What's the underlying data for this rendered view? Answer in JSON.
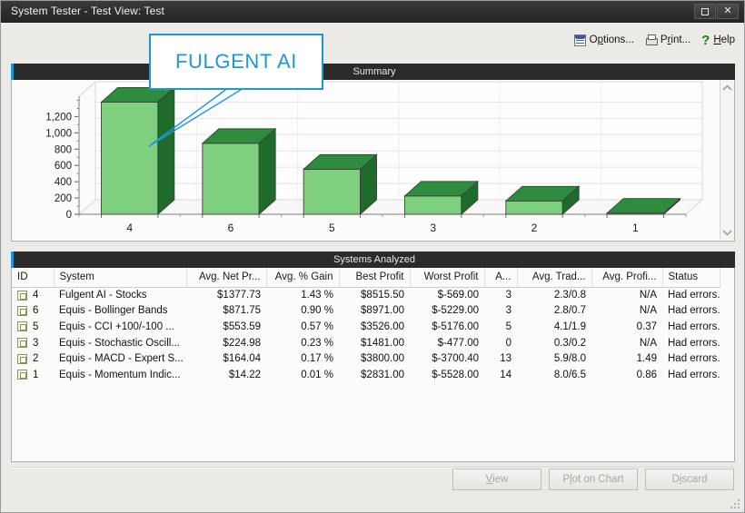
{
  "window": {
    "title": "System Tester - Test View: Test",
    "restore_label": "restore-window",
    "close_label": "✕"
  },
  "toolbar": {
    "options": {
      "pre": "O",
      "accel": "p",
      "post": "tions..."
    },
    "print": {
      "pre": "P",
      "accel": "r",
      "post": "int..."
    },
    "help": {
      "pre": "",
      "accel": "H",
      "post": "elp"
    },
    "help_glyph": "?"
  },
  "summary_panel": {
    "title": "Summary"
  },
  "systems_panel": {
    "title": "Systems Analyzed"
  },
  "chart_data": {
    "type": "bar",
    "title": "Summary",
    "xlabel": "",
    "ylabel": "",
    "categories": [
      "4",
      "6",
      "5",
      "3",
      "2",
      "1"
    ],
    "values": [
      1377.73,
      871.75,
      553.59,
      224.98,
      164.04,
      14.22
    ],
    "ylim": [
      0,
      1450
    ],
    "yticks": [
      0,
      200,
      400,
      600,
      800,
      1000,
      1200
    ],
    "ytick_labels": [
      "0",
      "200",
      "400",
      "600",
      "800",
      "1,000",
      "1,200"
    ],
    "grid": true,
    "legend": "none",
    "style": "3d-column",
    "bar_color": "#7ed07e",
    "bar_top_color": "#2f8b3d",
    "bar_side_color": "#1e6b2c"
  },
  "table": {
    "columns": [
      "ID",
      "System",
      "Avg. Net Pr...",
      "Avg. % Gain",
      "Best Profit",
      "Worst Profit",
      "A...",
      "Avg. Trad...",
      "Avg. Profi...",
      "Status"
    ],
    "rows": [
      {
        "id": "4",
        "system": "Fulgent AI - Stocks",
        "avg_net_profit": "$1377.73",
        "avg_pct_gain": "1.43 %",
        "best_profit": "$8515.50",
        "worst_profit": "$-569.00",
        "a": "3",
        "avg_trad": "2.3/0.8",
        "avg_profit": "N/A",
        "status": "Had errors."
      },
      {
        "id": "6",
        "system": "Equis - Bollinger Bands",
        "avg_net_profit": "$871.75",
        "avg_pct_gain": "0.90 %",
        "best_profit": "$8971.00",
        "worst_profit": "$-5229.00",
        "a": "3",
        "avg_trad": "2.8/0.7",
        "avg_profit": "N/A",
        "status": "Had errors."
      },
      {
        "id": "5",
        "system": "Equis - CCI +100/-100 ...",
        "avg_net_profit": "$553.59",
        "avg_pct_gain": "0.57 %",
        "best_profit": "$3526.00",
        "worst_profit": "$-5176.00",
        "a": "5",
        "avg_trad": "4.1/1.9",
        "avg_profit": "0.37",
        "status": "Had errors."
      },
      {
        "id": "3",
        "system": "Equis - Stochastic Oscill...",
        "avg_net_profit": "$224.98",
        "avg_pct_gain": "0.23 %",
        "best_profit": "$1481.00",
        "worst_profit": "$-477.00",
        "a": "0",
        "avg_trad": "0.3/0.2",
        "avg_profit": "N/A",
        "status": "Had errors."
      },
      {
        "id": "2",
        "system": "Equis - MACD - Expert S...",
        "avg_net_profit": "$164.04",
        "avg_pct_gain": "0.17 %",
        "best_profit": "$3800.00",
        "worst_profit": "$-3700.40",
        "a": "13",
        "avg_trad": "5.9/8.0",
        "avg_profit": "1.49",
        "status": "Had errors."
      },
      {
        "id": "1",
        "system": "Equis - Momentum Indic...",
        "avg_net_profit": "$14.22",
        "avg_pct_gain": "0.01 %",
        "best_profit": "$2831.00",
        "worst_profit": "$-5528.00",
        "a": "14",
        "avg_trad": "8.0/6.5",
        "avg_profit": "0.86",
        "status": "Had errors."
      }
    ]
  },
  "footer": {
    "view": {
      "pre": "",
      "accel": "V",
      "post": "iew"
    },
    "plot": {
      "pre": "P",
      "accel": "l",
      "post": "ot on Chart"
    },
    "discard": {
      "pre": "D",
      "accel": "i",
      "post": "scard"
    }
  },
  "callout": {
    "text": "FULGENT AI",
    "color": "#2196d6"
  }
}
